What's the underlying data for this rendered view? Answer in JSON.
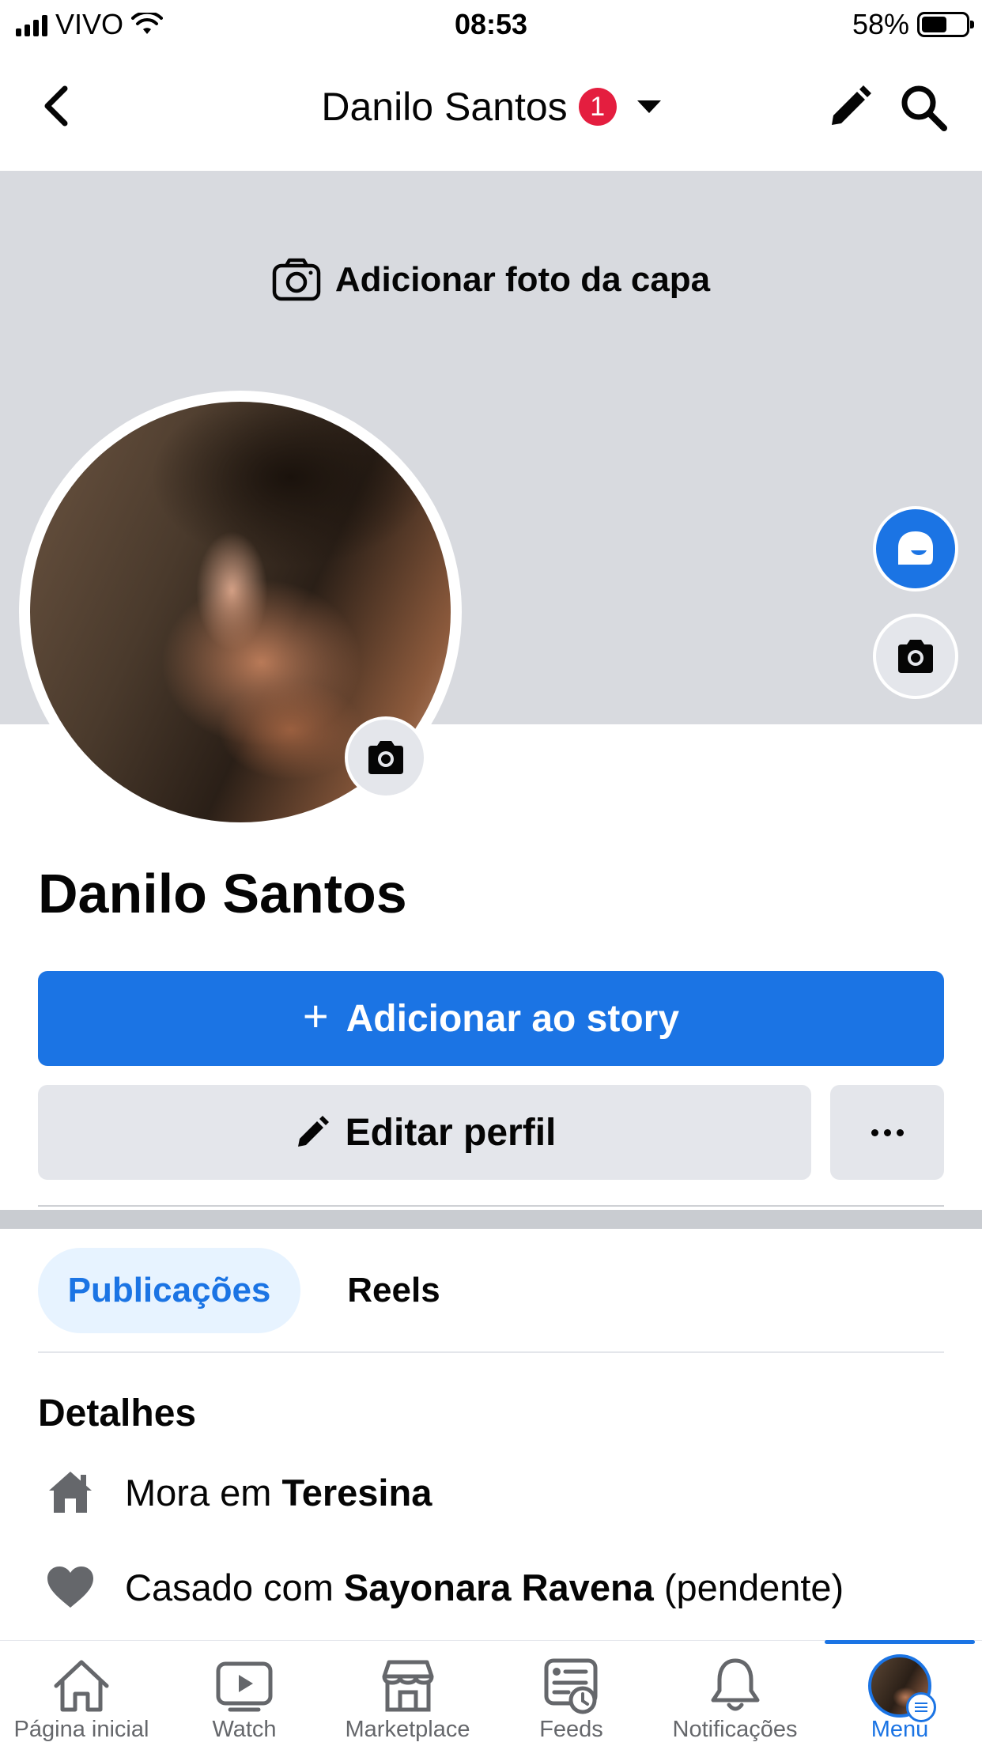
{
  "status_bar": {
    "carrier": "VIVO",
    "time": "08:53",
    "battery": "58%",
    "battery_level": 0.58
  },
  "header": {
    "title": "Danilo Santos",
    "badge_count": "1",
    "icons": [
      "back-arrow-icon",
      "caret-down-icon",
      "pencil-icon",
      "search-icon"
    ]
  },
  "cover": {
    "add_cover_label": "Adicionar foto da capa"
  },
  "profile": {
    "name": "Danilo Santos"
  },
  "actions": {
    "add_story_plus": "+",
    "add_story_label": "Adicionar ao story",
    "edit_profile_label": "Editar perfil"
  },
  "tabs": [
    {
      "label": "Publicações",
      "active": true
    },
    {
      "label": "Reels",
      "active": false
    }
  ],
  "details": {
    "title": "Detalhes",
    "lives_prefix": "Mora em",
    "lives_city": "Teresina",
    "relationship_prefix": "Casado com",
    "relationship_partner": "Sayonara Ravena",
    "relationship_status": "(pendente)"
  },
  "tab_bar": {
    "items": [
      {
        "label": "Página inicial",
        "icon": "home-icon"
      },
      {
        "label": "Watch",
        "icon": "watch-icon"
      },
      {
        "label": "Marketplace",
        "icon": "marketplace-icon"
      },
      {
        "label": "Feeds",
        "icon": "feeds-icon"
      },
      {
        "label": "Notificações",
        "icon": "bell-icon"
      },
      {
        "label": "Menu",
        "icon": "menu-avatar"
      }
    ],
    "active": "Menu"
  },
  "colors": {
    "primary": "#1b74e4",
    "badge": "#e41e3f",
    "cover_bg": "#d8dadf",
    "secondary_button": "#e4e6eb",
    "active_tab_bg": "#e7f3ff"
  }
}
